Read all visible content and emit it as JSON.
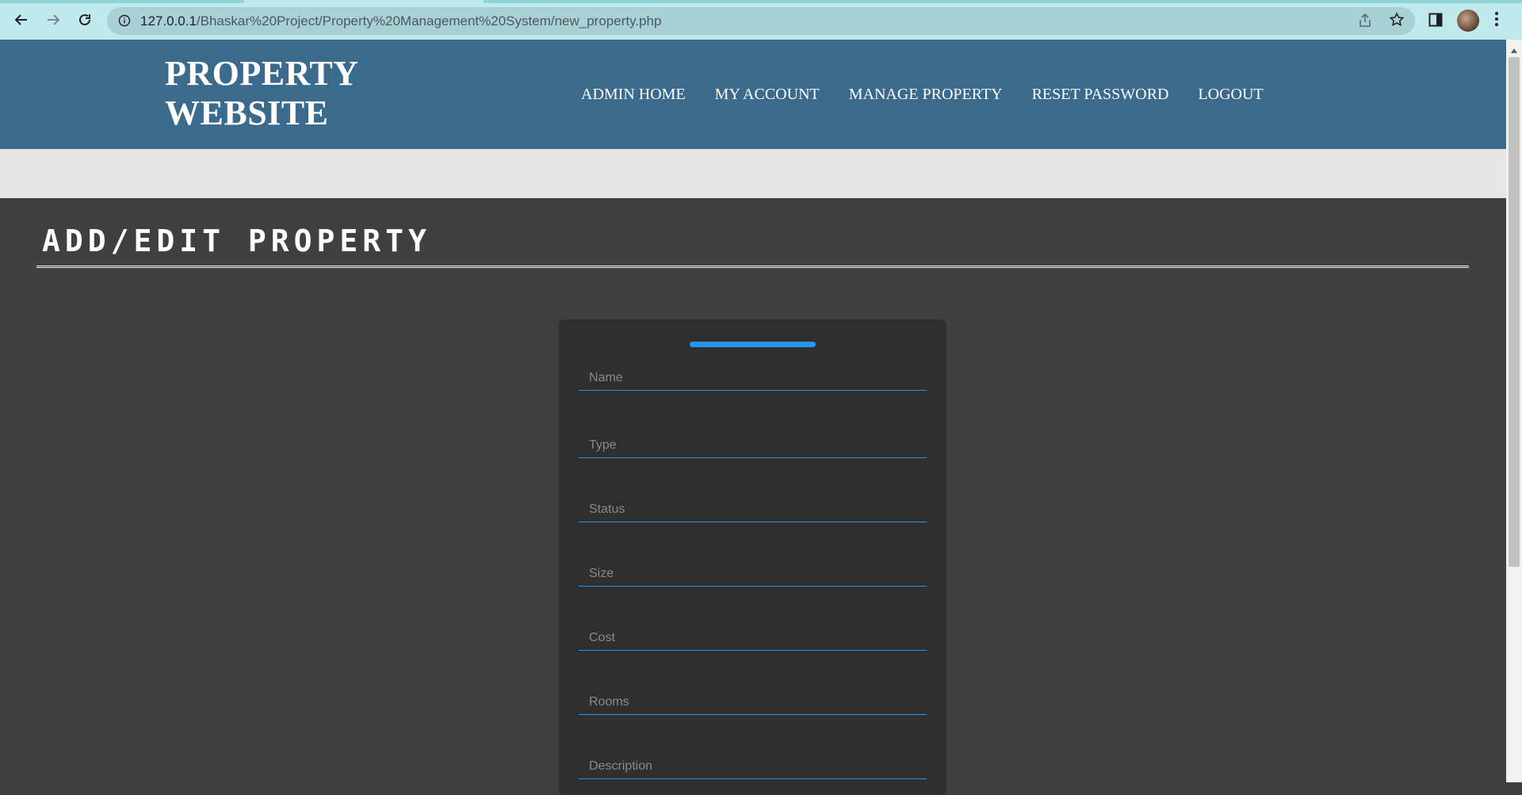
{
  "browser": {
    "url_host": "127.0.0.1",
    "url_path": "/Bhaskar%20Project/Property%20Management%20System/new_property.php"
  },
  "header": {
    "logo_line1": "PROPERTY",
    "logo_line2": "WEBSITE",
    "nav": [
      {
        "label": "ADMIN HOME"
      },
      {
        "label": "MY ACCOUNT"
      },
      {
        "label": "MANAGE PROPERTY"
      },
      {
        "label": "RESET PASSWORD"
      },
      {
        "label": "LOGOUT"
      }
    ]
  },
  "main": {
    "title": "ADD/EDIT PROPERTY"
  },
  "form": {
    "fields": [
      {
        "placeholder": "Name",
        "value": ""
      },
      {
        "placeholder": "Type",
        "value": ""
      },
      {
        "placeholder": "Status",
        "value": ""
      },
      {
        "placeholder": "Size",
        "value": ""
      },
      {
        "placeholder": "Cost",
        "value": ""
      },
      {
        "placeholder": "Rooms",
        "value": ""
      },
      {
        "placeholder": "Description",
        "value": ""
      }
    ]
  },
  "colors": {
    "header_bg": "#3a6a8c",
    "page_bg": "#404040",
    "card_bg": "#2f2f2f",
    "accent": "#2196f3"
  },
  "icons": [
    "back-arrow-icon",
    "forward-arrow-icon",
    "reload-icon",
    "info-icon",
    "share-icon",
    "star-icon",
    "side-panel-icon",
    "more-vert-icon"
  ]
}
